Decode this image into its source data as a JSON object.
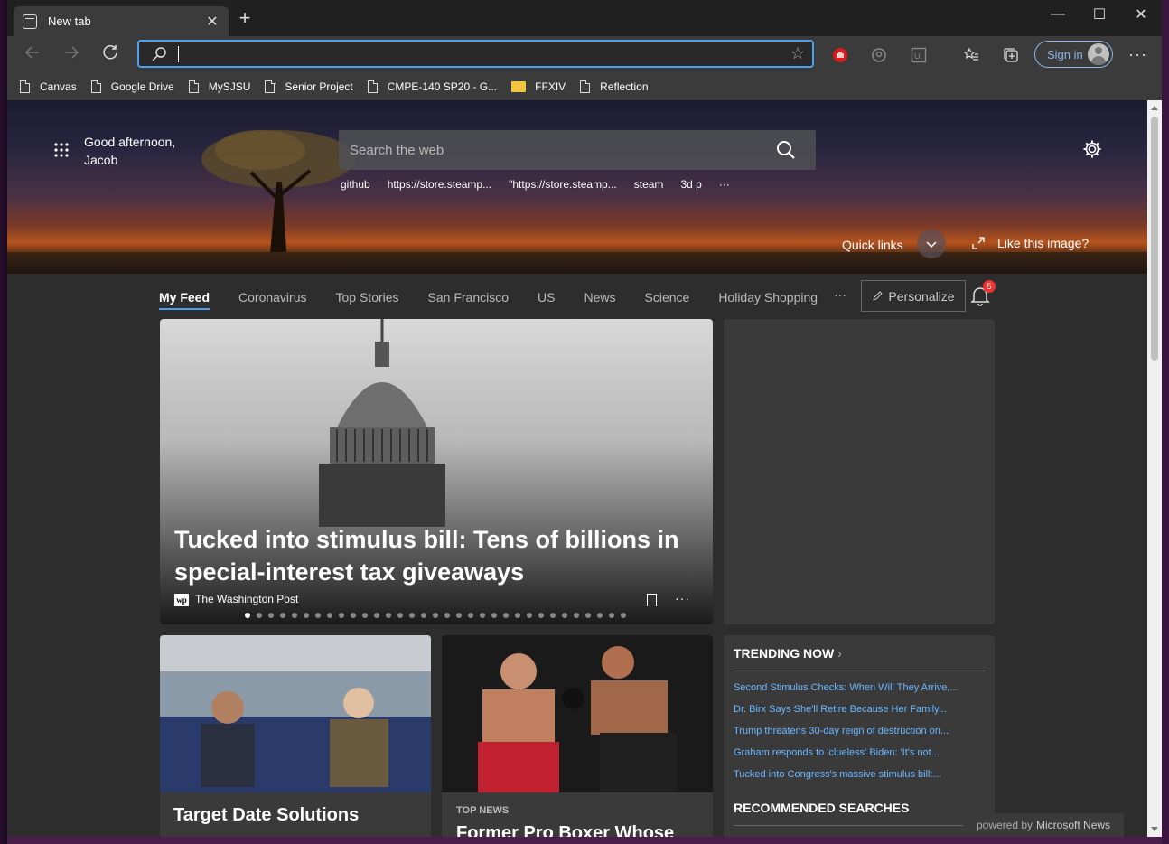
{
  "tab": {
    "title": "New tab"
  },
  "window_controls": {
    "minimize": "—",
    "maximize": "☐",
    "close": "✕"
  },
  "address": {
    "value": ""
  },
  "signin": {
    "label": "Sign in"
  },
  "bookmarks": [
    {
      "label": "Canvas",
      "icon": "page-icon"
    },
    {
      "label": "Google Drive",
      "icon": "page-icon"
    },
    {
      "label": "MySJSU",
      "icon": "page-icon"
    },
    {
      "label": "Senior Project",
      "icon": "page-icon"
    },
    {
      "label": "CMPE-140 SP20 - G...",
      "icon": "page-icon"
    },
    {
      "label": "FFXIV",
      "icon": "folder-icon"
    },
    {
      "label": "Reflection",
      "icon": "page-icon"
    }
  ],
  "hero": {
    "greeting_line1": "Good afternoon,",
    "greeting_line2": "Jacob",
    "search_placeholder": "Search the web",
    "suggestions": [
      "github",
      "https://store.steamp...",
      "\"https://store.steamp...",
      "steam",
      "3d p"
    ],
    "suggest_more": "···",
    "quick_links": "Quick links",
    "like_image": "Like this image?"
  },
  "feed_nav": {
    "items": [
      "My Feed",
      "Coronavirus",
      "Top Stories",
      "San Francisco",
      "US",
      "News",
      "Science",
      "Holiday Shopping"
    ],
    "more": "···",
    "personalize": "Personalize",
    "notification_count": "5"
  },
  "main_card": {
    "title": "Tucked into stimulus bill: Tens of billions in special-interest tax giveaways",
    "source_logo": "wp",
    "source": "The Washington Post",
    "more": "···",
    "carousel_total": 33,
    "carousel_active": 1
  },
  "card_target": {
    "title": "Target Date Solutions"
  },
  "card_boxing": {
    "label": "TOP NEWS",
    "title": "Former Pro Boxer Whose"
  },
  "trending": {
    "header": "TRENDING NOW",
    "items": [
      "Second Stimulus Checks: When Will They Arrive,...",
      "Dr. Birx Says She'll Retire Because Her Family...",
      "Trump threatens 30-day reign of destruction on...",
      "Graham responds to 'clueless' Biden: 'It's not...",
      "Tucked into Congress's massive stimulus bill:..."
    ],
    "recommended": "RECOMMENDED SEARCHES"
  },
  "powered": {
    "prefix": "powered by",
    "brand": "Microsoft News"
  }
}
